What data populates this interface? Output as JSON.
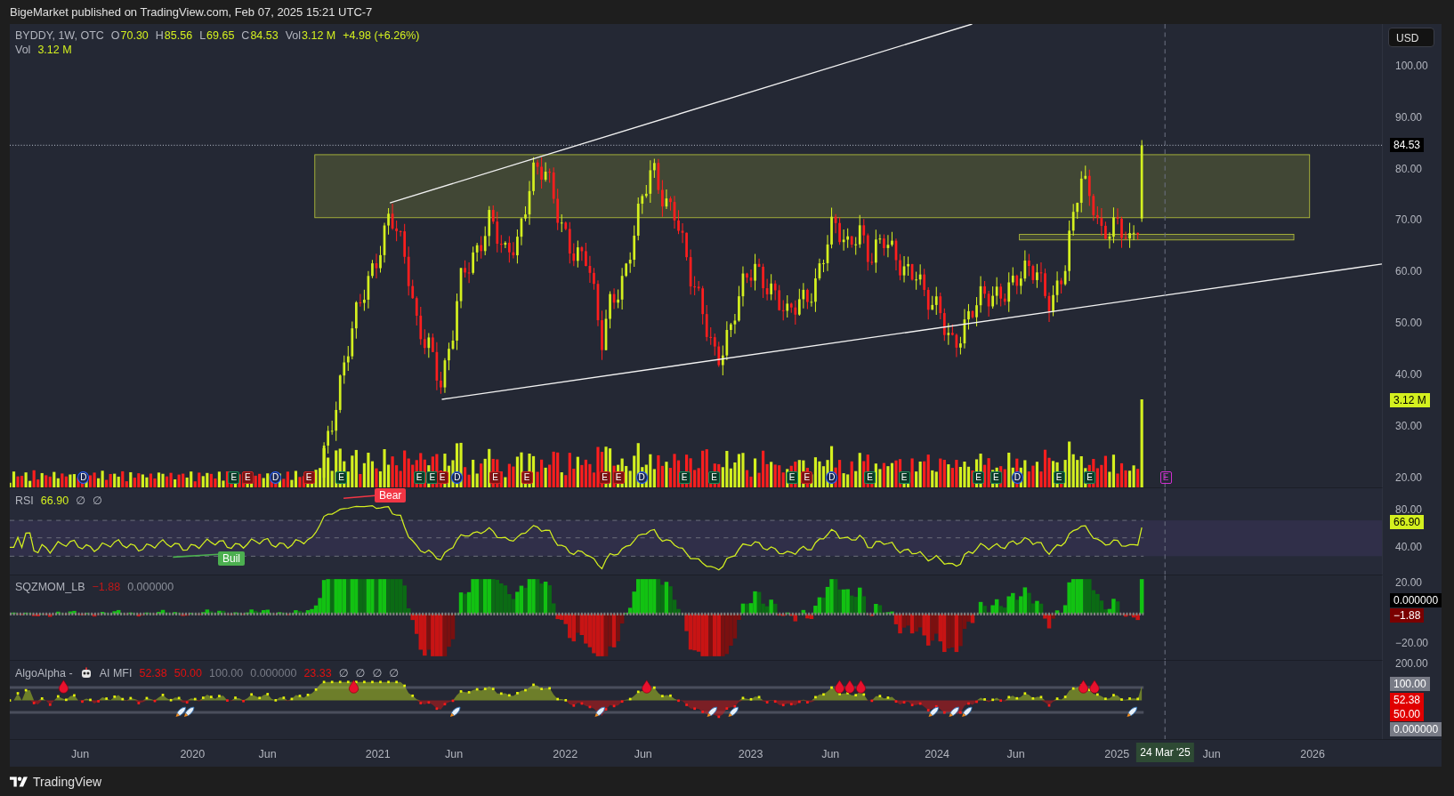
{
  "header": {
    "text": "BigeMarket published on TradingView.com, Feb 07, 2025 15:21 UTC-7"
  },
  "main_pane": {
    "legend": {
      "symbol": "BYDDY, 1W, OTC",
      "fields": [
        {
          "key": "O",
          "value": "70.30"
        },
        {
          "key": "H",
          "value": "85.56"
        },
        {
          "key": "L",
          "value": "69.65"
        },
        {
          "key": "C",
          "value": "84.53"
        },
        {
          "key": "Vol",
          "value": "3.12 M"
        }
      ],
      "change": "+4.98 (+6.26%)"
    },
    "volume_legend": {
      "label": "Vol",
      "value": "3.12 M"
    },
    "events": [
      {
        "label": "D",
        "kind": "dividend"
      },
      {
        "label": "E",
        "kind": "earnings_beat"
      },
      {
        "label": "E",
        "kind": "earnings_miss"
      },
      {
        "label": "D",
        "kind": "dividend"
      },
      {
        "label": "E",
        "kind": "earnings_miss"
      },
      {
        "label": "E",
        "kind": "earnings_beat"
      },
      {
        "label": "E",
        "kind": "earnings_beat"
      },
      {
        "label": "E",
        "kind": "earnings_beat"
      },
      {
        "label": "E",
        "kind": "earnings_miss"
      },
      {
        "label": "D",
        "kind": "dividend"
      },
      {
        "label": "E",
        "kind": "earnings_miss"
      },
      {
        "label": "E",
        "kind": "earnings_miss"
      },
      {
        "label": "E",
        "kind": "earnings_miss"
      },
      {
        "label": "E",
        "kind": "earnings_miss"
      },
      {
        "label": "D",
        "kind": "dividend"
      },
      {
        "label": "E",
        "kind": "earnings_beat"
      },
      {
        "label": "E",
        "kind": "earnings_beat"
      },
      {
        "label": "E",
        "kind": "earnings_beat"
      },
      {
        "label": "E",
        "kind": "earnings_miss"
      },
      {
        "label": "D",
        "kind": "dividend"
      },
      {
        "label": "E",
        "kind": "earnings_beat"
      },
      {
        "label": "E",
        "kind": "earnings_beat"
      },
      {
        "label": "E",
        "kind": "earnings_beat"
      },
      {
        "label": "E",
        "kind": "earnings_beat"
      },
      {
        "label": "D",
        "kind": "dividend"
      },
      {
        "label": "E",
        "kind": "earnings_beat"
      },
      {
        "label": "E",
        "kind": "earnings_beat"
      },
      {
        "label": "E",
        "kind": "earnings_upcoming"
      }
    ],
    "axis": {
      "currency": "USD",
      "ticks": [
        "100.00",
        "90.00",
        "80.00",
        "70.00",
        "60.00",
        "50.00",
        "40.00",
        "30.00",
        "20.00"
      ],
      "tags": [
        {
          "text": "84.53",
          "kind": "last_price"
        },
        {
          "text": "3.12 M",
          "kind": "volume"
        }
      ]
    }
  },
  "rsi_pane": {
    "legend": {
      "name": "RSI",
      "value": "66.90",
      "extras": [
        "∅",
        "∅"
      ]
    },
    "signals": [
      {
        "text": "Bear",
        "kind": "bearish"
      },
      {
        "text": "Buil",
        "kind": "bullish"
      }
    ],
    "axis": {
      "ticks": [
        "80.00",
        "40.00"
      ],
      "tags": [
        {
          "text": "66.90",
          "kind": "rsi"
        }
      ]
    }
  },
  "sqz_pane": {
    "legend": {
      "name": "SQZMOM_LB",
      "values": [
        {
          "text": "−1.88",
          "kind": "negative"
        },
        {
          "text": "0.000000",
          "kind": "zero"
        }
      ]
    },
    "axis": {
      "ticks": [
        "20.00",
        "−20.00"
      ],
      "tags": [
        {
          "text": "0.000000",
          "kind": "zero"
        },
        {
          "text": "−1.88",
          "kind": "negative"
        }
      ]
    }
  },
  "mfi_pane": {
    "legend": {
      "name": "AlgoAlpha -",
      "title": "AI MFI",
      "values": [
        {
          "text": "52.38",
          "kind": "bearish"
        },
        {
          "text": "50.00",
          "kind": "bearish"
        },
        {
          "text": "100.00",
          "kind": "neutral"
        },
        {
          "text": "0.000000",
          "kind": "neutral"
        },
        {
          "text": "23.33",
          "kind": "bearish"
        }
      ],
      "extras": [
        "∅",
        "∅",
        "∅",
        "∅"
      ]
    },
    "axis": {
      "ticks": [
        "200.00"
      ],
      "tags": [
        {
          "text": "100.00",
          "kind": "neutral"
        },
        {
          "text": "52.38",
          "kind": "bearish"
        },
        {
          "text": "50.00",
          "kind": "bearish"
        },
        {
          "text": "0.000000",
          "kind": "neutral"
        }
      ]
    }
  },
  "time_axis": {
    "ticks": [
      "Jun",
      "2020",
      "Jun",
      "2021",
      "Jun",
      "2022",
      "Jun",
      "2023",
      "Jun",
      "2024",
      "Jun",
      "2025",
      "Jun",
      "2026"
    ],
    "crosshair_label": "24 Mar '25"
  },
  "footer": {
    "brand": "TradingView"
  }
}
